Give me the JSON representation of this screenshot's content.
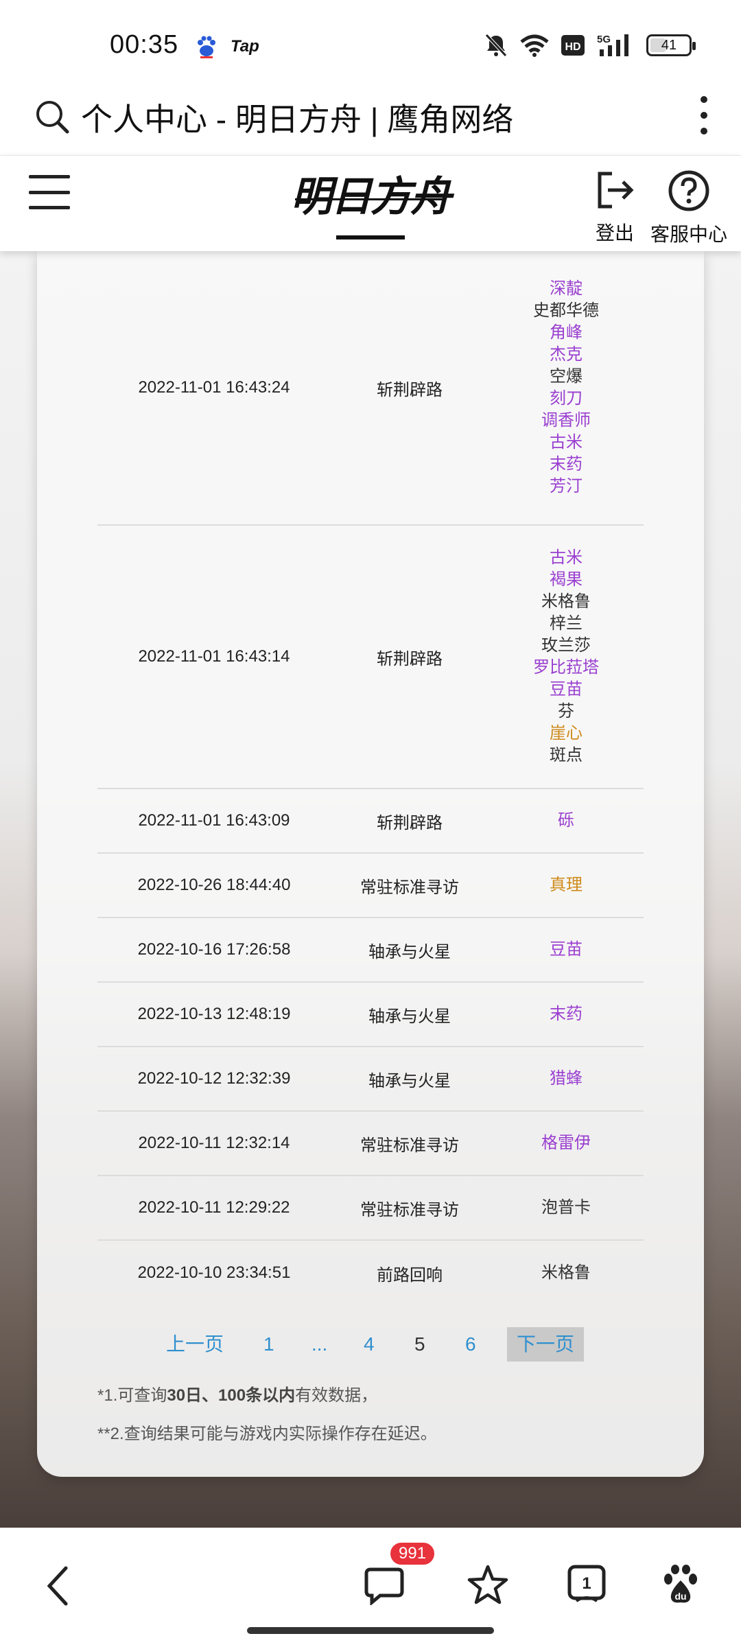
{
  "status": {
    "time": "00:35",
    "tap_label": "Tap",
    "battery": "41",
    "battery_level": 0.41,
    "icons": [
      "baidu-icon",
      "mute-icon",
      "wifi-icon",
      "hd-icon",
      "5g-signal-icon",
      "battery-icon"
    ]
  },
  "browser": {
    "page_title": "个人中心 - 明日方舟 | 鹰角网络"
  },
  "header": {
    "logo_text": "明日方舟",
    "logout_label": "登出",
    "service_label": "客服中心"
  },
  "records": [
    {
      "time": "2022-11-01 16:43:24",
      "pool": "斩荆辟路",
      "operators": [
        {
          "name": "深靛",
          "rarity": "r4"
        },
        {
          "name": "史都华德",
          "rarity": "r3"
        },
        {
          "name": "角峰",
          "rarity": "r4"
        },
        {
          "name": "杰克",
          "rarity": "r4"
        },
        {
          "name": "空爆",
          "rarity": "r3"
        },
        {
          "name": "刻刀",
          "rarity": "r4"
        },
        {
          "name": "调香师",
          "rarity": "r4"
        },
        {
          "name": "古米",
          "rarity": "r4"
        },
        {
          "name": "末药",
          "rarity": "r4"
        },
        {
          "name": "芳汀",
          "rarity": "r4"
        }
      ]
    },
    {
      "time": "2022-11-01 16:43:14",
      "pool": "斩荆辟路",
      "operators": [
        {
          "name": "古米",
          "rarity": "r4"
        },
        {
          "name": "褐果",
          "rarity": "r4"
        },
        {
          "name": "米格鲁",
          "rarity": "r3"
        },
        {
          "name": "梓兰",
          "rarity": "r3"
        },
        {
          "name": "玫兰莎",
          "rarity": "r3"
        },
        {
          "name": "罗比菈塔",
          "rarity": "r4"
        },
        {
          "name": "豆苗",
          "rarity": "r4"
        },
        {
          "name": "芬",
          "rarity": "r3"
        },
        {
          "name": "崖心",
          "rarity": "r5"
        },
        {
          "name": "斑点",
          "rarity": "r3"
        }
      ]
    },
    {
      "time": "2022-11-01 16:43:09",
      "pool": "斩荆辟路",
      "operators": [
        {
          "name": "砾",
          "rarity": "r4"
        }
      ]
    },
    {
      "time": "2022-10-26 18:44:40",
      "pool": "常驻标准寻访",
      "operators": [
        {
          "name": "真理",
          "rarity": "r5"
        }
      ]
    },
    {
      "time": "2022-10-16 17:26:58",
      "pool": "轴承与火星",
      "operators": [
        {
          "name": "豆苗",
          "rarity": "r4"
        }
      ]
    },
    {
      "time": "2022-10-13 12:48:19",
      "pool": "轴承与火星",
      "operators": [
        {
          "name": "末药",
          "rarity": "r4"
        }
      ]
    },
    {
      "time": "2022-10-12 12:32:39",
      "pool": "轴承与火星",
      "operators": [
        {
          "name": "猎蜂",
          "rarity": "r4"
        }
      ]
    },
    {
      "time": "2022-10-11 12:32:14",
      "pool": "常驻标准寻访",
      "operators": [
        {
          "name": "格雷伊",
          "rarity": "r4"
        }
      ]
    },
    {
      "time": "2022-10-11 12:29:22",
      "pool": "常驻标准寻访",
      "operators": [
        {
          "name": "泡普卡",
          "rarity": "r3"
        }
      ]
    },
    {
      "time": "2022-10-10 23:34:51",
      "pool": "前路回响",
      "operators": [
        {
          "name": "米格鲁",
          "rarity": "r3"
        }
      ]
    }
  ],
  "pager": {
    "prev": "上一页",
    "pages": [
      "1",
      "...",
      "4",
      "5",
      "6"
    ],
    "current": "5",
    "next": "下一页"
  },
  "notes": {
    "note1_prefix": "*1.可查询",
    "note1_bold": "30日、100条以内",
    "note1_suffix": "有效数据，",
    "note2": "**2.查询结果可能与游戏内实际操作存在延迟。"
  },
  "bottom_nav": {
    "badge": "991",
    "icons": [
      "back-icon",
      "message-icon",
      "star-icon",
      "tabs-icon",
      "baidu-paw-icon"
    ],
    "tabs_count": "1"
  },
  "colors": {
    "rarity3": "#333333",
    "rarity4": "#9a3fd0",
    "rarity5": "#cf8a1a",
    "link": "#2f8fce"
  }
}
